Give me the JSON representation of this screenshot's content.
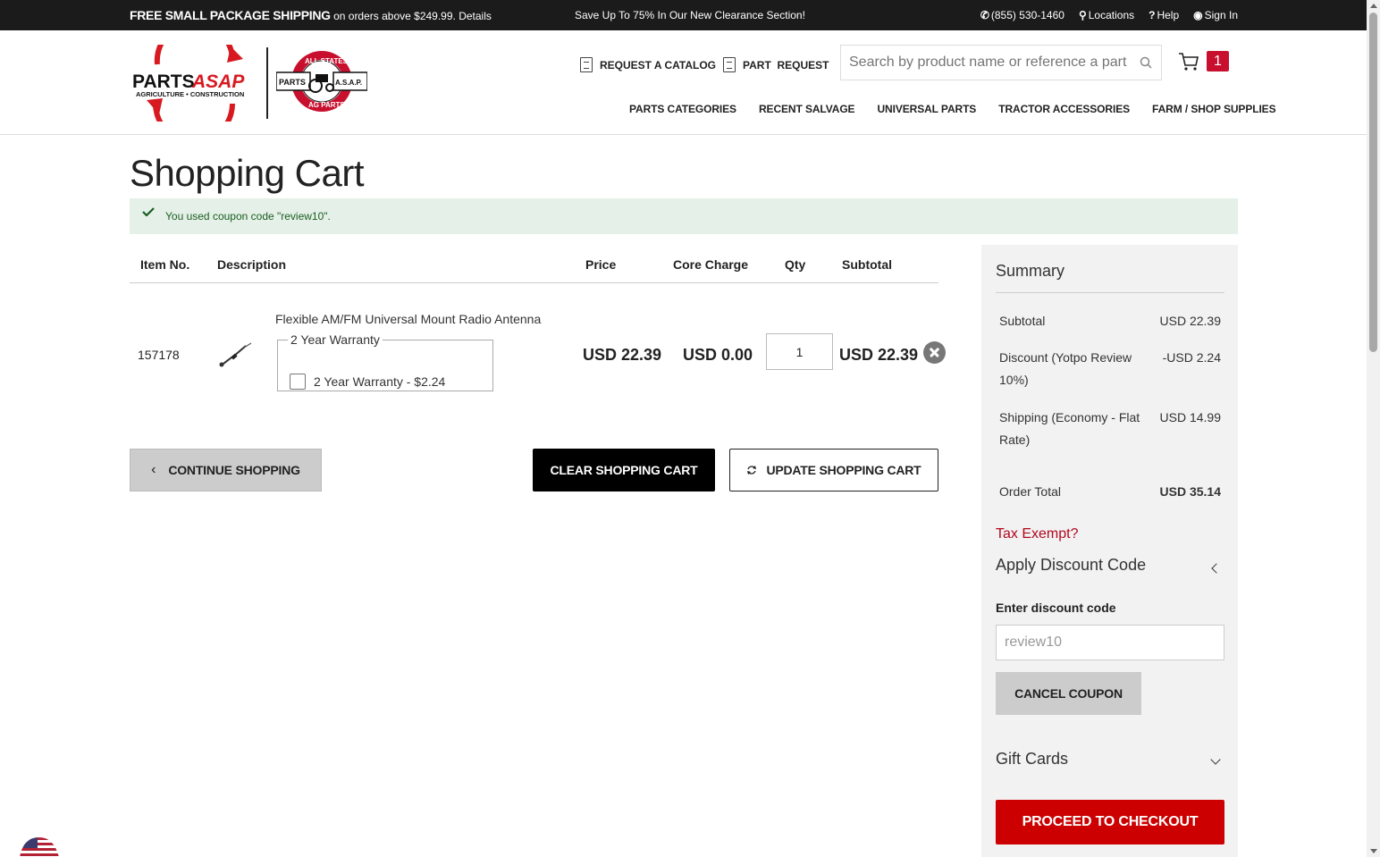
{
  "topbar": {
    "promo_bold": "FREE SMALL PACKAGE SHIPPING",
    "promo_rest": " on orders above $249.99. Details",
    "center": "Save Up To 75% In Our New Clearance Section!",
    "phone": "(855) 530-1460",
    "locations": "Locations",
    "help": "Help",
    "signin": "Sign In"
  },
  "header": {
    "request_catalog": "REQUEST A CATALOG",
    "part_request": "PART  REQUEST",
    "search_placeholder": "Search by product name or reference a part #",
    "cart_count": "1",
    "nav": [
      "PARTS CATEGORIES",
      "RECENT SALVAGE",
      "UNIVERSAL PARTS",
      "TRACTOR ACCESSORIES",
      "FARM / SHOP SUPPLIES"
    ]
  },
  "page": {
    "title": "Shopping Cart",
    "notice": "You used coupon code \"review10\"."
  },
  "table": {
    "headers": {
      "item_no": "Item No.",
      "description": "Description",
      "price": "Price",
      "core_charge": "Core Charge",
      "qty": "Qty",
      "subtotal": "Subtotal"
    },
    "rows": [
      {
        "item_no": "157178",
        "name": "Flexible AM/FM Universal Mount Radio Antenna",
        "warranty_legend": "2 Year Warranty",
        "warranty_option": "2 Year Warranty - $2.24",
        "price": "USD 22.39",
        "core_charge": "USD 0.00",
        "qty": "1",
        "subtotal": "USD 22.39"
      }
    ]
  },
  "actions": {
    "continue": "CONTINUE SHOPPING",
    "clear": "CLEAR SHOPPING CART",
    "update": "UPDATE SHOPPING CART"
  },
  "summary": {
    "title": "Summary",
    "rows": [
      {
        "label": "Subtotal",
        "value": "USD 22.39"
      },
      {
        "label": "Discount (Yotpo Review 10%)",
        "value": "-USD 2.24"
      },
      {
        "label": "Shipping (Economy - Flat Rate)",
        "value": "USD 14.99"
      },
      {
        "label": "Order Total",
        "value": "USD 35.14"
      }
    ],
    "tax_exempt": "Tax Exempt?",
    "apply_discount": "Apply Discount Code",
    "enter_code_label": "Enter discount code",
    "code_value": "review10",
    "cancel_coupon": "CANCEL COUPON",
    "gift_cards": "Gift Cards",
    "checkout": "PROCEED TO CHECKOUT"
  },
  "logos": {
    "parts": "PARTS",
    "asap": "ASAP",
    "tagline": "AGRICULTURE • CONSTRUCTION",
    "seal_top": "ALL STATES",
    "seal_left": "PARTS",
    "seal_right": "A.S.A.P.",
    "seal_bottom": "AG PARTS"
  },
  "colors": {
    "brand_red": "#cc0000",
    "success_bg": "#e5f0e8",
    "topbar_bg": "#1b1b1b"
  }
}
